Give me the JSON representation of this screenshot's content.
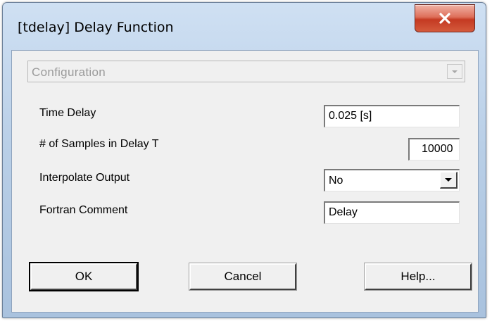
{
  "window": {
    "title": "[tdelay] Delay Function",
    "close_glyph": "✕"
  },
  "configuration": {
    "selected": "Configuration"
  },
  "fields": {
    "time_delay": {
      "label": "Time Delay",
      "value": "0.025 [s]"
    },
    "samples": {
      "label": "# of Samples in Delay T",
      "value": "10000"
    },
    "interpolate": {
      "label": "Interpolate Output",
      "value": "No"
    },
    "fortran_comment": {
      "label": "Fortran Comment",
      "value": "Delay"
    }
  },
  "buttons": {
    "ok": "OK",
    "cancel": "Cancel",
    "help": "Help..."
  },
  "icons": {
    "close": "close-icon",
    "dropdown": "chevron-down-icon"
  },
  "colors": {
    "close_button": "#c43a22",
    "title_bar": "#b9cfe7",
    "dialog_face": "#f0f0f0"
  }
}
